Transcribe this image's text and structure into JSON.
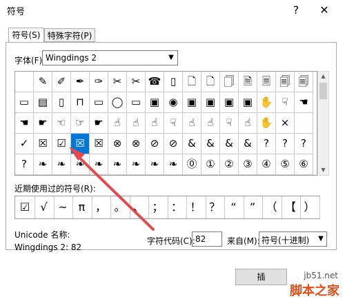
{
  "window": {
    "title": "符号",
    "help": "?",
    "close": "✕"
  },
  "tabs": [
    {
      "label": "符号(S)"
    },
    {
      "label": "特殊字符(P)"
    }
  ],
  "font": {
    "label": "字体(F):",
    "value": "Wingdings 2"
  },
  "grid": {
    "selected": "3,3",
    "rows": [
      [
        "",
        "✎",
        "✐",
        "✒",
        "✑",
        "✂",
        "✂",
        "☎",
        "▯",
        "🗋",
        "🗋",
        "🗍",
        "🗎",
        "🗏",
        "🗐",
        "🗐"
      ],
      [
        "▭",
        "▤",
        "▯",
        "⊓",
        "▭",
        "◯",
        "▭",
        "▣",
        "◉",
        "▣",
        "▣",
        "▣",
        "▣",
        "✋",
        "☟",
        "☚"
      ],
      [
        "☚",
        "☛",
        "☜",
        "☞",
        "☛",
        "☝",
        "☝",
        "☝",
        "☟",
        "☝",
        "☝",
        "☟",
        "☝",
        "✋",
        "×",
        ""
      ],
      [
        "✓",
        "☒",
        "☑",
        "☒",
        "☒",
        "⊗",
        "⊗",
        "⊘",
        "⊘",
        "&",
        "&",
        "&",
        "&",
        "?",
        "?",
        "?"
      ],
      [
        "?",
        "❧",
        "❧",
        "❧",
        "❧",
        "❧",
        "❧",
        "❧",
        "❧",
        "⓪",
        "①",
        "②",
        "③",
        "④",
        "⑤",
        "⑥"
      ]
    ]
  },
  "recent": {
    "label": "近期使用过的符号(R):",
    "symbols": [
      "☑",
      "√",
      "~",
      "π",
      "，",
      "。",
      "、",
      "；",
      "：",
      "！",
      "？",
      "“",
      "”",
      "（",
      "【",
      "）"
    ]
  },
  "unicode": {
    "name_label": "Unicode 名称:",
    "name_value": "Wingdings 2: 82"
  },
  "char_code": {
    "label": "字符代码(C):",
    "value": "82"
  },
  "from": {
    "label": "来自(M):",
    "value": "符号(十进制)"
  },
  "buttons": {
    "insert": "插"
  },
  "watermark": {
    "url": "jb51.net",
    "name": "脚本之家"
  },
  "colors": {
    "selection": "#0078d7",
    "annotation_arrow": "#e8474b"
  }
}
